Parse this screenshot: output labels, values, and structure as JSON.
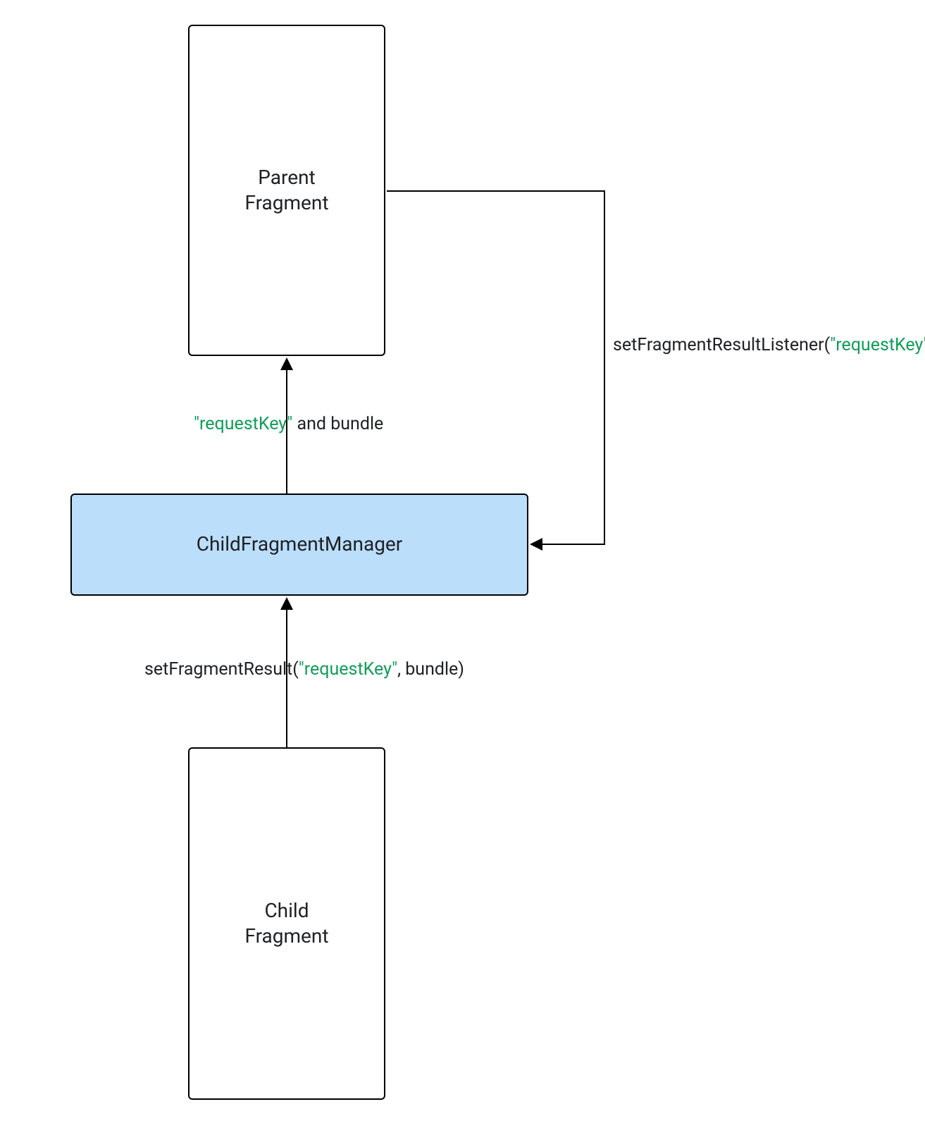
{
  "nodes": {
    "parent": {
      "line1": "Parent",
      "line2": "Fragment"
    },
    "manager": {
      "label": "ChildFragmentManager"
    },
    "child": {
      "line1": "Child",
      "line2": "Fragment"
    }
  },
  "edges": {
    "listener": {
      "prefix": "setFragmentResultListener(",
      "key": "\"requestKey\"",
      "suffix": ")"
    },
    "result_bundle": {
      "key": "\"requestKey\"",
      "suffix": " and bundle"
    },
    "set_result": {
      "prefix": "setFragmentResult(",
      "key": "\"requestKey\"",
      "suffix": ", bundle)"
    }
  },
  "colors": {
    "highlight": "#0f9d58",
    "manager_bg": "#bbdefb"
  }
}
